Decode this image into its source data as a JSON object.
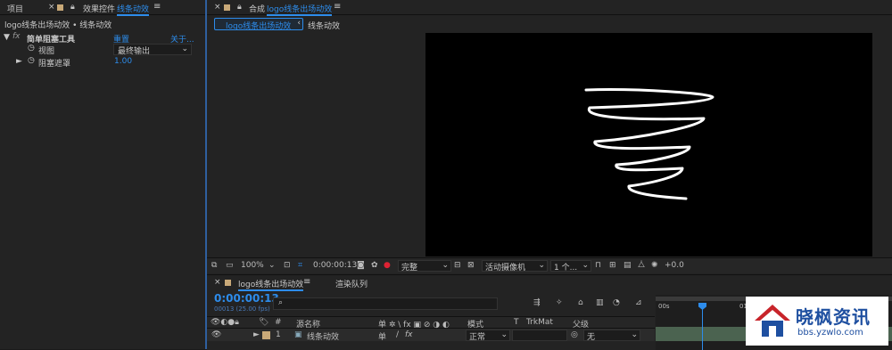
{
  "left_panel": {
    "tab_project": "项目",
    "tab_effects": "效果控件",
    "tab_effects_target": "线条动效",
    "breadcrumb": "logo线条出场动效 • 线条动效",
    "fx_label": "fx",
    "effect_name": "简单阻塞工具",
    "reset_label": "重置",
    "about_label": "关于...",
    "prop_view_label": "视图",
    "prop_view_value": "最终输出",
    "prop_matte_label": "阻塞遮罩",
    "prop_matte_value": "1.00"
  },
  "comp_panel": {
    "title_prefix": "合成",
    "title_comp": "logo线条出场动效",
    "tab_main": "logo线条出场动效",
    "tab_sub": "线条动效",
    "zoom": "100%",
    "timecode": "0:00:00:13",
    "resolution": "完整",
    "camera": "活动摄像机",
    "views": "1 个...",
    "exposure": "+0.0"
  },
  "timeline": {
    "tab_comp": "logo线条出场动效",
    "tab_render": "渲染队列",
    "timecode": "0:00:00:13",
    "fps_label": "00013 (25.00 fps)",
    "search_placeholder": "",
    "col_index": "#",
    "col_source": "源名称",
    "col_switch_icons": "单 ✲ \\ fx ▣ ⊘ ◑ ◐",
    "col_mode": "模式",
    "col_t": "T",
    "col_trkmat": "TrkMat",
    "col_parent": "父级",
    "layer_index": "1",
    "layer_name": "线条动效",
    "layer_mode": "正常",
    "layer_parent": "无",
    "ruler_start": "00s",
    "ruler_next": "01s"
  },
  "watermark": {
    "name": "晓枫资讯",
    "url": "bbs.yzwlo.com"
  }
}
